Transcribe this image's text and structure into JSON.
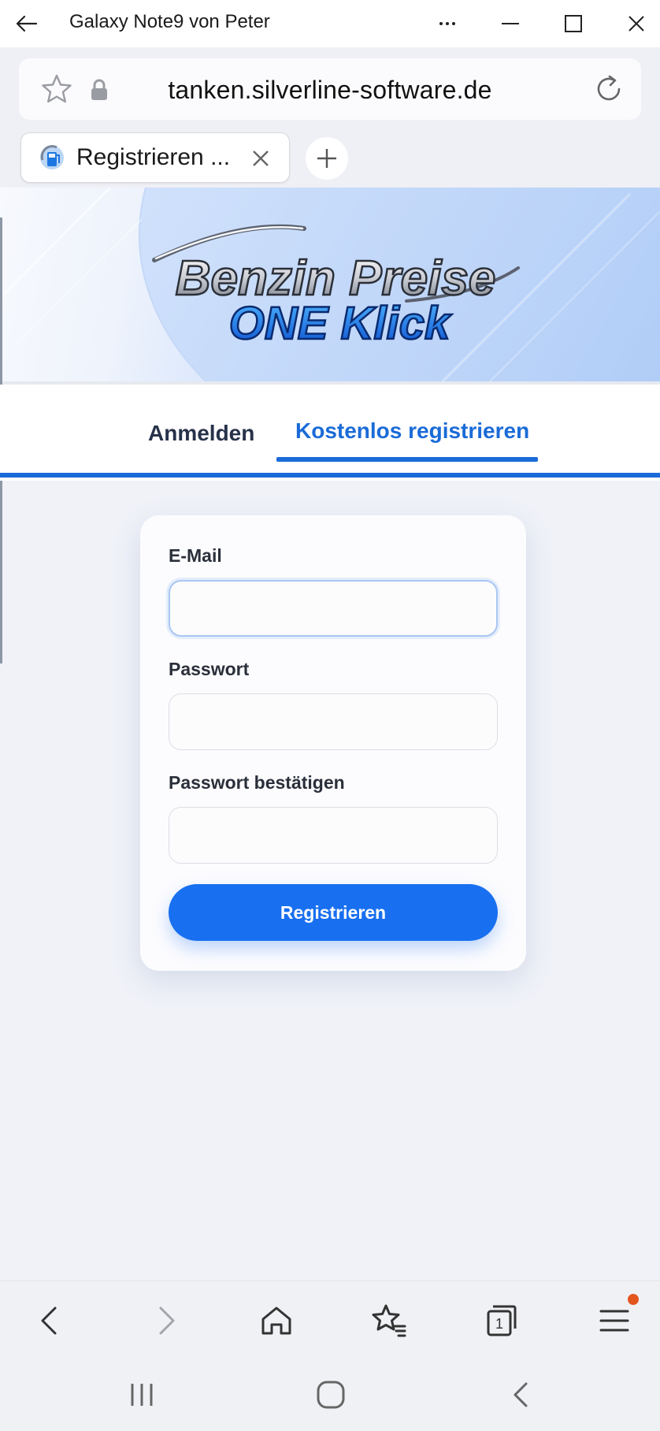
{
  "window": {
    "title": "Galaxy Note9 von Peter"
  },
  "browser": {
    "url": "tanken.silverline-software.de",
    "tab_title": "Registrieren ..."
  },
  "banner": {
    "logo_line1": "Benzin Preise",
    "logo_line2": "ONE Klick"
  },
  "nav": {
    "tab_login": "Anmelden",
    "tab_register": "Kostenlos registrieren",
    "active": "Kostenlos registrieren"
  },
  "form": {
    "email_label": "E-Mail",
    "email_value": "",
    "password_label": "Passwort",
    "password_value": "",
    "confirm_label": "Passwort bestätigen",
    "confirm_value": "",
    "submit_label": "Registrieren"
  },
  "colors": {
    "accent": "#186ff0",
    "tab_active": "#1a6bd8",
    "notification_dot": "#e3561e"
  },
  "icons": {
    "toolbar": [
      "back-icon",
      "forward-icon",
      "home-icon",
      "bookmarks-icon",
      "tabs-icon",
      "menu-icon"
    ],
    "system": [
      "recent-apps-icon",
      "home-button-icon",
      "system-back-icon"
    ]
  },
  "toolbar": {
    "tab_count": "1"
  }
}
